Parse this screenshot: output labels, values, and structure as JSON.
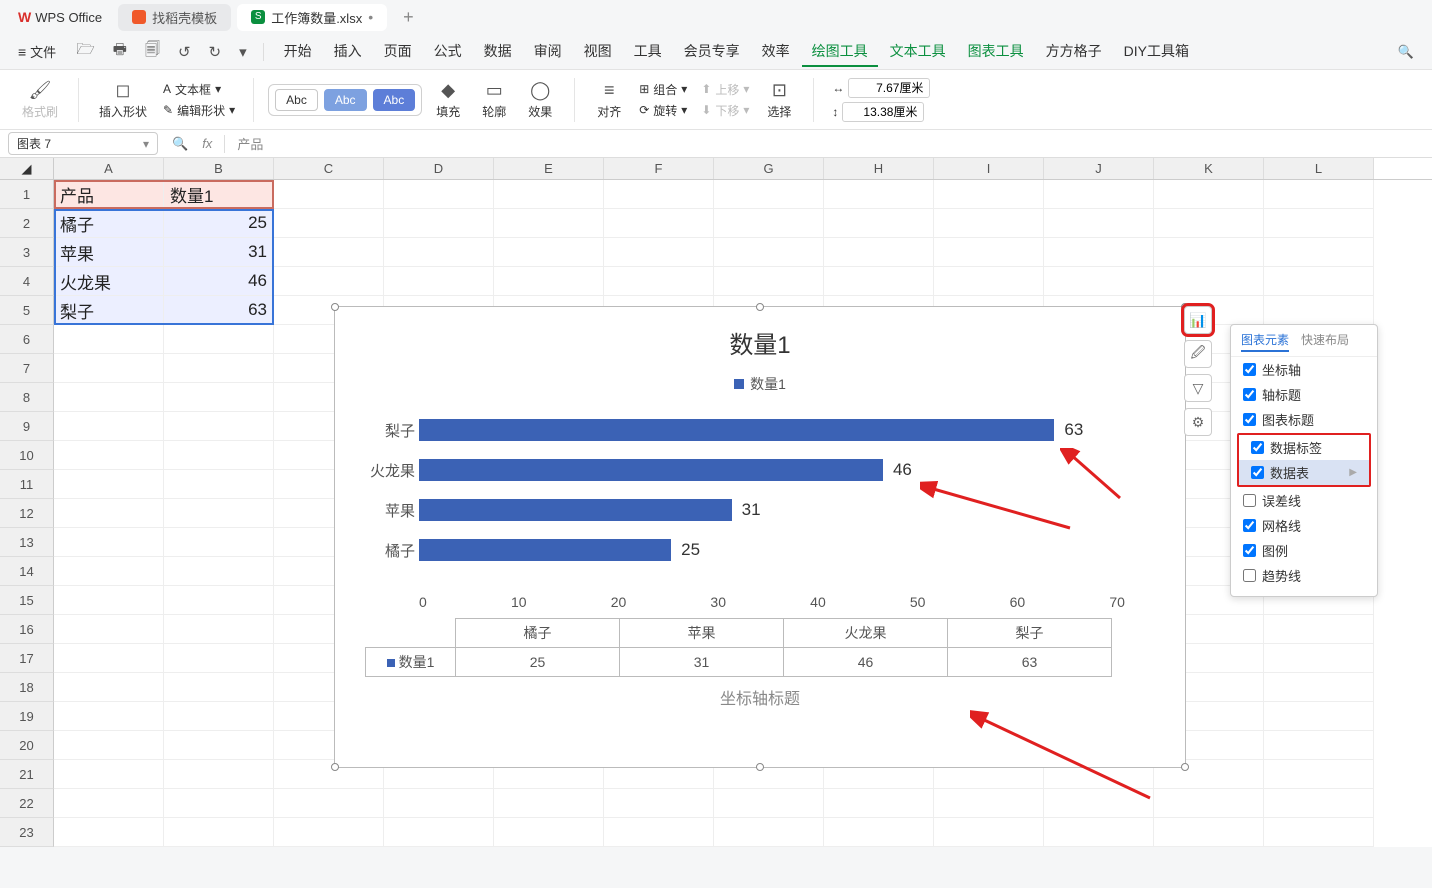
{
  "titlebar": {
    "app_name": "WPS Office",
    "tabs": [
      {
        "icon": "orange",
        "label": "找稻壳模板"
      },
      {
        "icon": "green",
        "green_letter": "S",
        "label": "工作簿数量.xlsx",
        "dirty": "•",
        "active": true
      }
    ],
    "add": "+"
  },
  "qat": {
    "file": "文件"
  },
  "ribbon_tabs": [
    "开始",
    "插入",
    "页面",
    "公式",
    "数据",
    "审阅",
    "视图",
    "工具",
    "会员专享",
    "效率",
    "绘图工具",
    "文本工具",
    "图表工具",
    "方方格子",
    "DIY工具箱"
  ],
  "ribbon_active": "绘图工具",
  "toolbar": {
    "format_painter": "格式刷",
    "insert_shape": "插入形状",
    "textbox": "文本框",
    "edit_shape": "编辑形状",
    "abc": "Abc",
    "fill": "填充",
    "outline": "轮廓",
    "effect": "效果",
    "align": "对齐",
    "group": "组合",
    "rotate": "旋转",
    "move_up": "上移",
    "move_down": "下移",
    "select": "选择",
    "width_val": "7.67厘米",
    "height_val": "13.38厘米"
  },
  "namebox": "图表 7",
  "formula": "产品",
  "columns": [
    "A",
    "B",
    "C",
    "D",
    "E",
    "F",
    "G",
    "H",
    "I",
    "J",
    "K",
    "L"
  ],
  "rows": 23,
  "data_cells": {
    "A1": "产品",
    "B1": "数量1",
    "A2": "橘子",
    "B2": "25",
    "A3": "苹果",
    "B3": "31",
    "A4": "火龙果",
    "B4": "46",
    "A5": "梨子",
    "B5": "63"
  },
  "chart_data": {
    "type": "bar",
    "title": "数量1",
    "legend": "数量1",
    "categories": [
      "橘子",
      "苹果",
      "火龙果",
      "梨子"
    ],
    "values": [
      25,
      31,
      46,
      63
    ],
    "display_order": [
      "梨子",
      "火龙果",
      "苹果",
      "橘子"
    ],
    "xlim": [
      0,
      70
    ],
    "xticks": [
      0,
      10,
      20,
      30,
      40,
      50,
      60,
      70
    ],
    "axis_title": "坐标轴标题",
    "data_table_series_label": "数量1"
  },
  "ce_panel": {
    "tab1": "图表元素",
    "tab2": "快速布局",
    "items": [
      {
        "label": "坐标轴",
        "checked": true
      },
      {
        "label": "轴标题",
        "checked": true
      },
      {
        "label": "图表标题",
        "checked": true
      },
      {
        "label": "数据标签",
        "checked": true,
        "hl": true
      },
      {
        "label": "数据表",
        "checked": true,
        "hl": true,
        "sel": true,
        "arrow": true
      },
      {
        "label": "误差线",
        "checked": false
      },
      {
        "label": "网格线",
        "checked": true
      },
      {
        "label": "图例",
        "checked": true
      },
      {
        "label": "趋势线",
        "checked": false
      }
    ]
  }
}
